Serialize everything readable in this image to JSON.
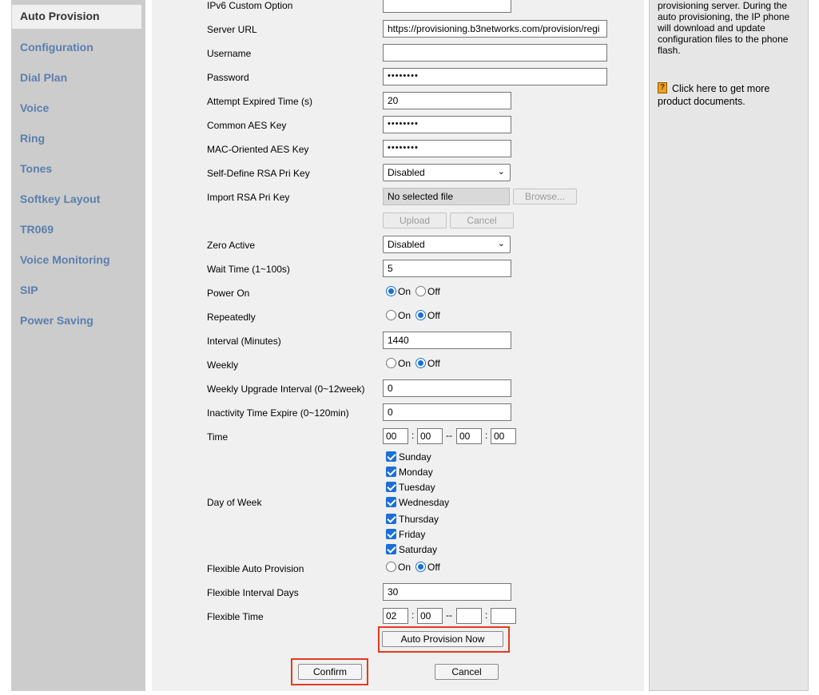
{
  "sidebar": {
    "items": [
      {
        "label": "Auto Provision",
        "active": true
      },
      {
        "label": "Configuration"
      },
      {
        "label": "Dial Plan"
      },
      {
        "label": "Voice"
      },
      {
        "label": "Ring"
      },
      {
        "label": "Tones"
      },
      {
        "label": "Softkey Layout"
      },
      {
        "label": "TR069"
      },
      {
        "label": "Voice Monitoring"
      },
      {
        "label": "SIP"
      },
      {
        "label": "Power Saving"
      }
    ]
  },
  "form": {
    "ipv6_custom_option": {
      "label": "IPv6 Custom Option",
      "value": ""
    },
    "server_url": {
      "label": "Server URL",
      "value": "https://provisioning.b3networks.com/provision/regi"
    },
    "username": {
      "label": "Username",
      "value": ""
    },
    "password": {
      "label": "Password",
      "value": "••••••••"
    },
    "attempt_expired": {
      "label": "Attempt Expired Time (s)",
      "value": "20"
    },
    "common_aes": {
      "label": "Common AES Key",
      "value": "••••••••"
    },
    "mac_aes": {
      "label": "MAC-Oriented AES Key",
      "value": "••••••••"
    },
    "rsa_pri_key": {
      "label": "Self-Define RSA Pri Key",
      "value": "Disabled"
    },
    "import_rsa": {
      "label": "Import RSA Pri Key",
      "file_text": "No selected file",
      "browse_label": "Browse...",
      "upload_label": "Upload",
      "cancel_label": "Cancel"
    },
    "zero_active": {
      "label": "Zero Active",
      "value": "Disabled"
    },
    "wait_time": {
      "label": "Wait Time (1~100s)",
      "value": "5"
    },
    "power_on": {
      "label": "Power On",
      "selected": "On"
    },
    "repeatedly": {
      "label": "Repeatedly",
      "selected": "Off"
    },
    "interval": {
      "label": "Interval (Minutes)",
      "value": "1440"
    },
    "weekly": {
      "label": "Weekly",
      "selected": "Off"
    },
    "weekly_upgrade_interval": {
      "label": "Weekly Upgrade Interval (0~12week)",
      "value": "0"
    },
    "inactivity_time": {
      "label": "Inactivity Time Expire (0~120min)",
      "value": "0"
    },
    "time": {
      "label": "Time",
      "h1": "00",
      "m1": "00",
      "h2": "00",
      "m2": "00"
    },
    "day_of_week": {
      "label": "Day of Week",
      "days": [
        "Sunday",
        "Monday",
        "Tuesday",
        "Wednesday",
        "Thursday",
        "Friday",
        "Saturday"
      ]
    },
    "flexible_auto_provision": {
      "label": "Flexible Auto Provision",
      "selected": "Off"
    },
    "flexible_interval_days": {
      "label": "Flexible Interval Days",
      "value": "30"
    },
    "flexible_time": {
      "label": "Flexible Time",
      "h1": "02",
      "m1": "00",
      "h2": "",
      "m2": ""
    },
    "radio_on": "On",
    "radio_off": "Off",
    "time_colon": ":",
    "time_dash": "--"
  },
  "buttons": {
    "auto_provision_now": "Auto Provision Now",
    "confirm": "Confirm",
    "cancel": "Cancel"
  },
  "help": {
    "text": "provisioning server. During the auto provisioning, the IP phone will download and update configuration files to the phone flash.",
    "link": "Click here to get more product documents."
  },
  "colors": {
    "sidebar_bg": "#cccccc",
    "sidebar_link": "#5b7fae",
    "highlight": "#e33a1f",
    "accent": "#1a6fd8"
  }
}
